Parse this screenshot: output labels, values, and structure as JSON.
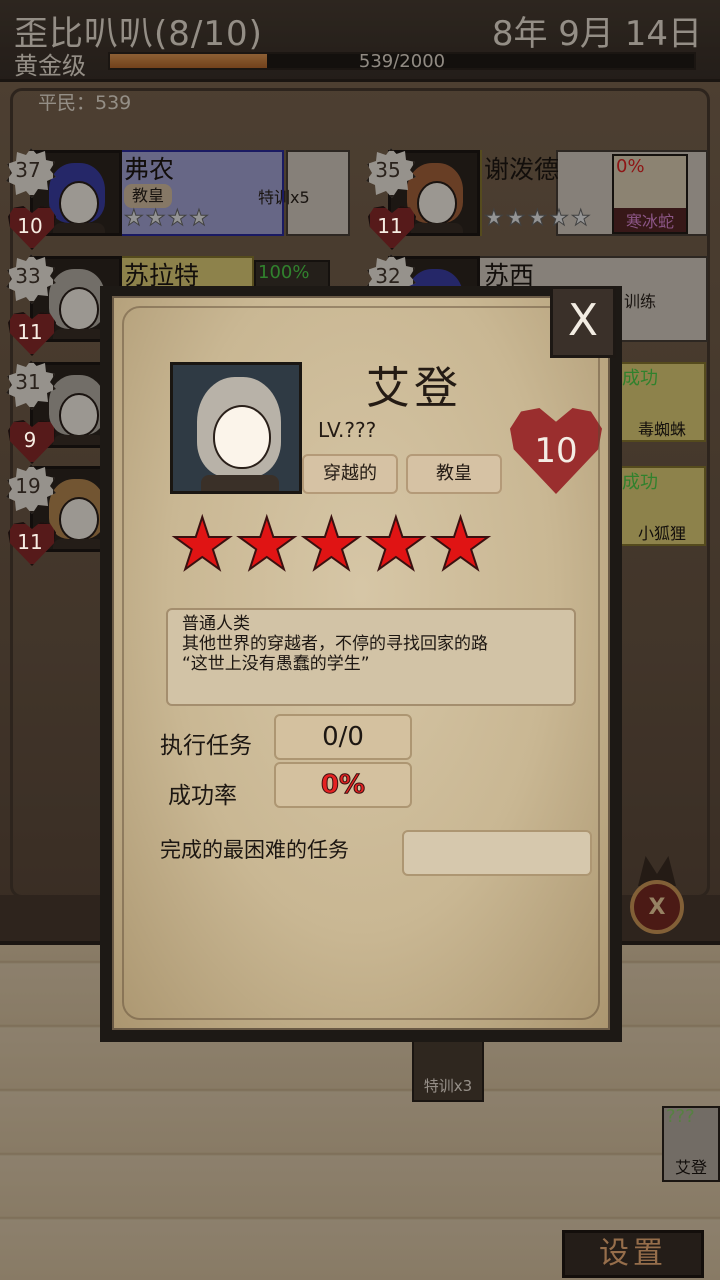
{
  "header": {
    "academy_name": "歪比叭叭(8/10)",
    "date": "8年 9月 14日",
    "rank": "黄金级",
    "xp_text": "539/2000",
    "xp_fraction": 0.2695
  },
  "commoners": "平民：539",
  "students": [
    {
      "level": "37",
      "loyalty": "10",
      "name": "弗农",
      "role": "教皇",
      "note": "特训x5",
      "stars": "★★★★"
    },
    {
      "level": "35",
      "loyalty": "11",
      "name": "谢泼德",
      "role": "",
      "note": "",
      "stars": "★★★★★",
      "task": {
        "pct": "0%",
        "name": "寒冰蛇"
      }
    },
    {
      "level": "33",
      "loyalty": "11",
      "name": "苏拉特",
      "role": "",
      "note": "",
      "stars": "",
      "task": {
        "pct": "100%",
        "name": ""
      }
    },
    {
      "level": "32",
      "loyalty": "",
      "name": "苏西",
      "role": "",
      "note": "独自训练",
      "stars": ""
    },
    {
      "level": "31",
      "loyalty": "9",
      "name": "",
      "role": "",
      "note": "",
      "stars": "",
      "task": {
        "pct": "成功",
        "name": "毒蜘蛛"
      }
    },
    {
      "level": "19",
      "loyalty": "11",
      "name": "",
      "role": "",
      "note": "",
      "stars": "",
      "task": {
        "pct": "成功",
        "name": "小狐狸"
      }
    }
  ],
  "dialog": {
    "close_label": "X",
    "name": "艾登",
    "level": "LV.???",
    "tags": [
      "穿越的",
      "教皇"
    ],
    "loyalty": "10",
    "stars": "★★★★★",
    "description": [
      "普通人类",
      "其他世界的穿越者，不停的寻找回家的路",
      "“这世上没有愚蠢的学生”"
    ],
    "stats": {
      "missions_label": "执行任务",
      "missions_value": "0/0",
      "success_label": "成功率",
      "success_value": "0%",
      "hardest_label": "完成的最困难的任务",
      "hardest_value": ""
    }
  },
  "bottom": {
    "train_tag": "特训x3",
    "mini_level": "???",
    "mini_name": "艾登",
    "settings_label": "设置",
    "cancel_symbol": "X"
  },
  "colors": {
    "heart_red": "#9a2e2e",
    "star_red": "#e01414",
    "success_green": "#4fd14a",
    "fail_red": "#e52222",
    "settings_orange": "#f2b27a"
  }
}
